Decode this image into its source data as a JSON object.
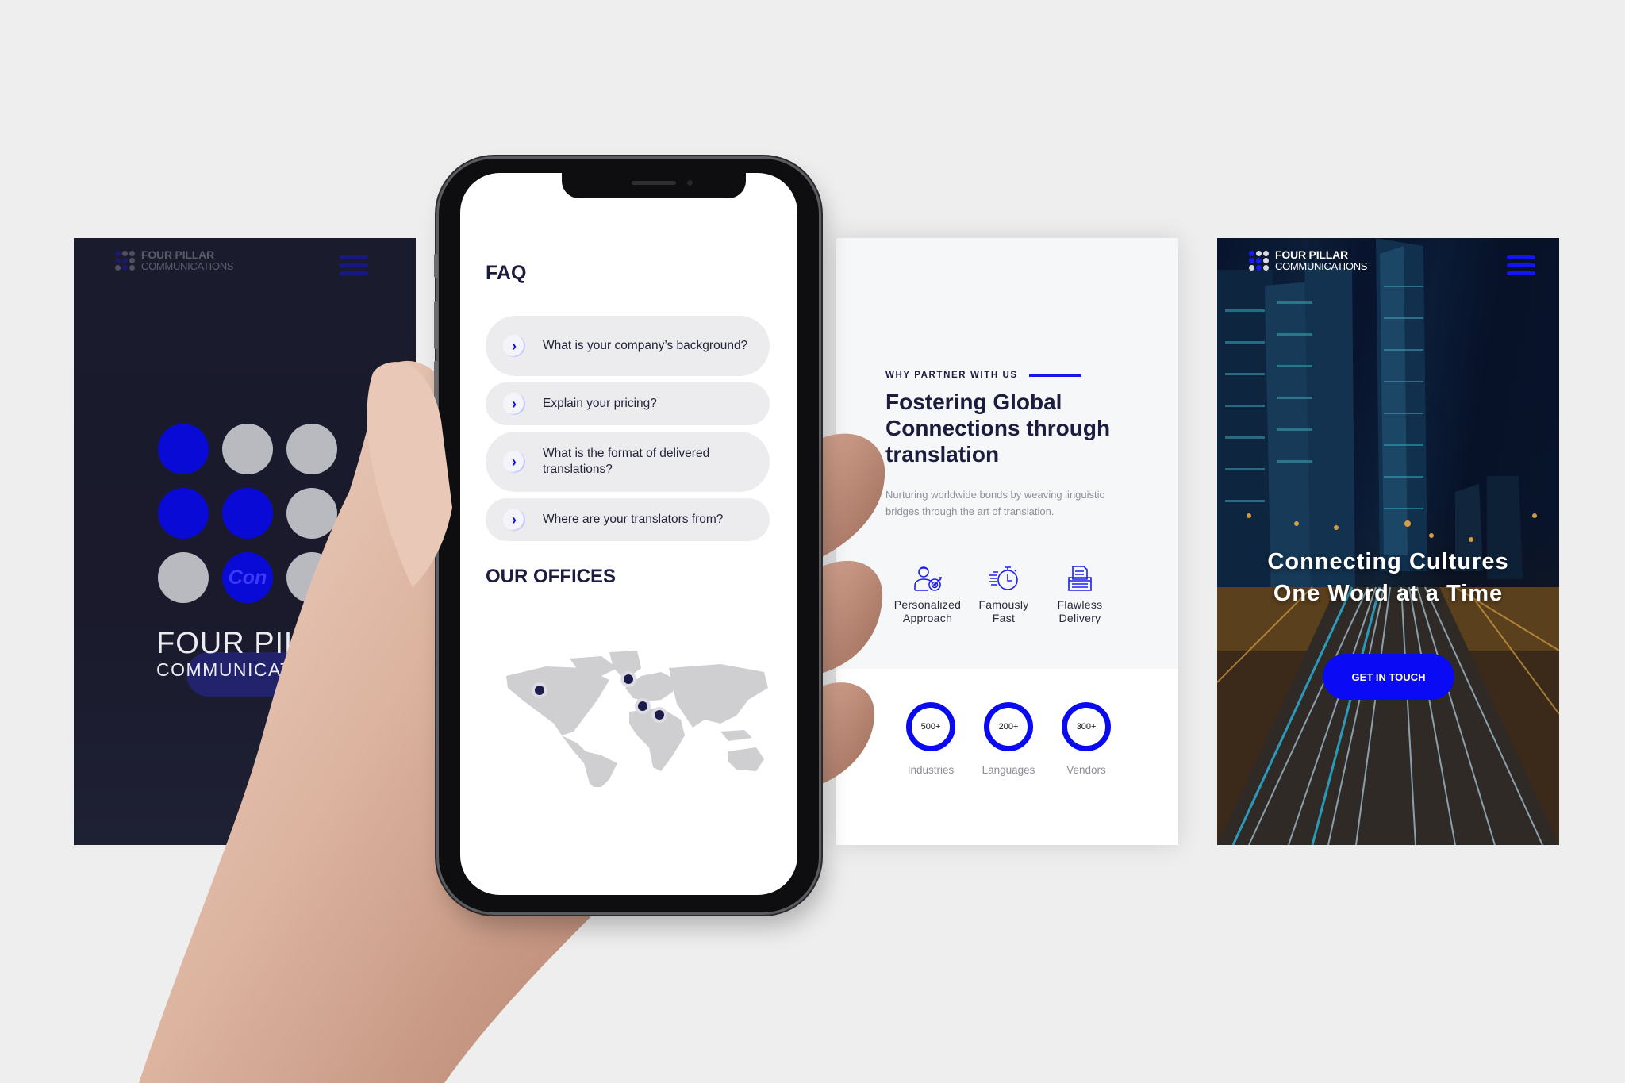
{
  "brand": {
    "name_line1": "FOUR PILLAR",
    "name_line2": "COMMUNICATIONS"
  },
  "colors": {
    "accent": "#0a0af0",
    "navy": "#1c1c3f",
    "background": "#eeeeee",
    "dot_gray": "#b9bac0"
  },
  "splash_panel": {
    "header_logo_line1": "FOUR PILLAR",
    "header_logo_line2": "COMMUNICATIONS",
    "menu_icon": "hamburger-icon",
    "logo_dots": [
      "blue",
      "gray",
      "gray",
      "blue",
      "blue",
      "gray",
      "gray",
      "blue",
      "gray"
    ],
    "overlay_text": "Con",
    "brand_line1": "FOUR PILLAR",
    "brand_line2": "COMMUNICATIONS"
  },
  "phone": {
    "faq_title": "FAQ",
    "faq_items": [
      {
        "question": "What is your company’s background?",
        "icon": "chevron-right-icon"
      },
      {
        "question": "Explain your pricing?",
        "icon": "chevron-right-icon"
      },
      {
        "question": "What is the format of delivered translations?",
        "icon": "chevron-right-icon"
      },
      {
        "question": "Where are your translators from?",
        "icon": "chevron-right-icon"
      }
    ],
    "offices_title": "OUR OFFICES",
    "office_markers": [
      "North America",
      "Northern Europe",
      "Middle East",
      "Arabian Peninsula"
    ]
  },
  "why_panel": {
    "eyebrow": "WHY PARTNER WITH US",
    "heading": "Fostering Global Connections through translation",
    "subtext_line1": "Nurturing worldwide bonds by weaving linguistic",
    "subtext_line2": "bridges through the art of translation.",
    "features": [
      {
        "label_line1": "Personalized",
        "label_line2": "Approach",
        "icon": "person-target-icon"
      },
      {
        "label_line1": "Famously",
        "label_line2": "Fast",
        "icon": "stopwatch-icon"
      },
      {
        "label_line1": "Flawless",
        "label_line2": "Delivery",
        "icon": "document-tray-icon"
      }
    ],
    "stats": [
      {
        "value": "500+",
        "label": "Industries"
      },
      {
        "value": "200+",
        "label": "Languages"
      },
      {
        "value": "300+",
        "label": "Vendors"
      }
    ]
  },
  "hero_panel": {
    "logo_line1": "FOUR PILLAR",
    "logo_line2": "COMMUNICATIONS",
    "menu_icon": "hamburger-icon",
    "headline_line1": "Connecting Cultures",
    "headline_line2": "One Word at a Time",
    "cta_label": "GET IN TOUCH"
  }
}
